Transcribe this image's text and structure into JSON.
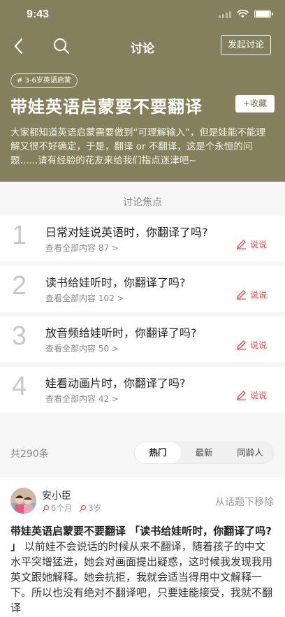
{
  "status_bar": {
    "time": "9:43"
  },
  "nav": {
    "title": "讨论",
    "start_button": "发起讨论"
  },
  "topic": {
    "tag": "# 3-6岁英语启蒙",
    "title": "带娃英语启蒙要不要翻译",
    "favorite_button": "+收藏",
    "description": "大家都知道英语启蒙需要做到“可理解输入”，但是娃能不能理解又很不好确定，于是，翻译 or 不翻译，这是个永恒的问题......请有经验的花友来给我们指点迷津吧~"
  },
  "focus": {
    "heading": "讨论焦点",
    "say_label": "说说",
    "items": [
      {
        "number": "1",
        "question": "日常对娃说英语时，你翻译了吗?",
        "view_all": "查看全部内容 87 >"
      },
      {
        "number": "2",
        "question": "读书给娃听时，你翻译了吗?",
        "view_all": "查看全部内容 102 >"
      },
      {
        "number": "3",
        "question": "放音频给娃听时，你翻译了吗?",
        "view_all": "查看全部内容 50 >"
      },
      {
        "number": "4",
        "question": "娃看动画片时，你翻译了吗?",
        "view_all": "查看全部内容 42 >"
      }
    ]
  },
  "list": {
    "count": "共290条",
    "tabs": [
      {
        "label": "热门",
        "active": true
      },
      {
        "label": "最新",
        "active": false
      },
      {
        "label": "同龄人",
        "active": false
      }
    ]
  },
  "post": {
    "author": "安小臣",
    "meta_time": "6个月",
    "meta_age": "3岁",
    "remove_label": "从话题下移除",
    "lead": "带娃英语启蒙要不要翻译 「读书给娃听时，你翻译了吗? 」",
    "body": " 以前娃不会说话的时候从来不翻译，随着孩子的中文水平突增猛进，她会对画面提出疑惑，这时候我发现我用英文跟她解释。她会抗拒，我就会适当得用中文解释一下。所以也没有绝对不翻译吧，只要娃能接受，我就不翻译"
  },
  "colors": {
    "header_bg": "#83805b",
    "accent_red": "#d9534f"
  }
}
